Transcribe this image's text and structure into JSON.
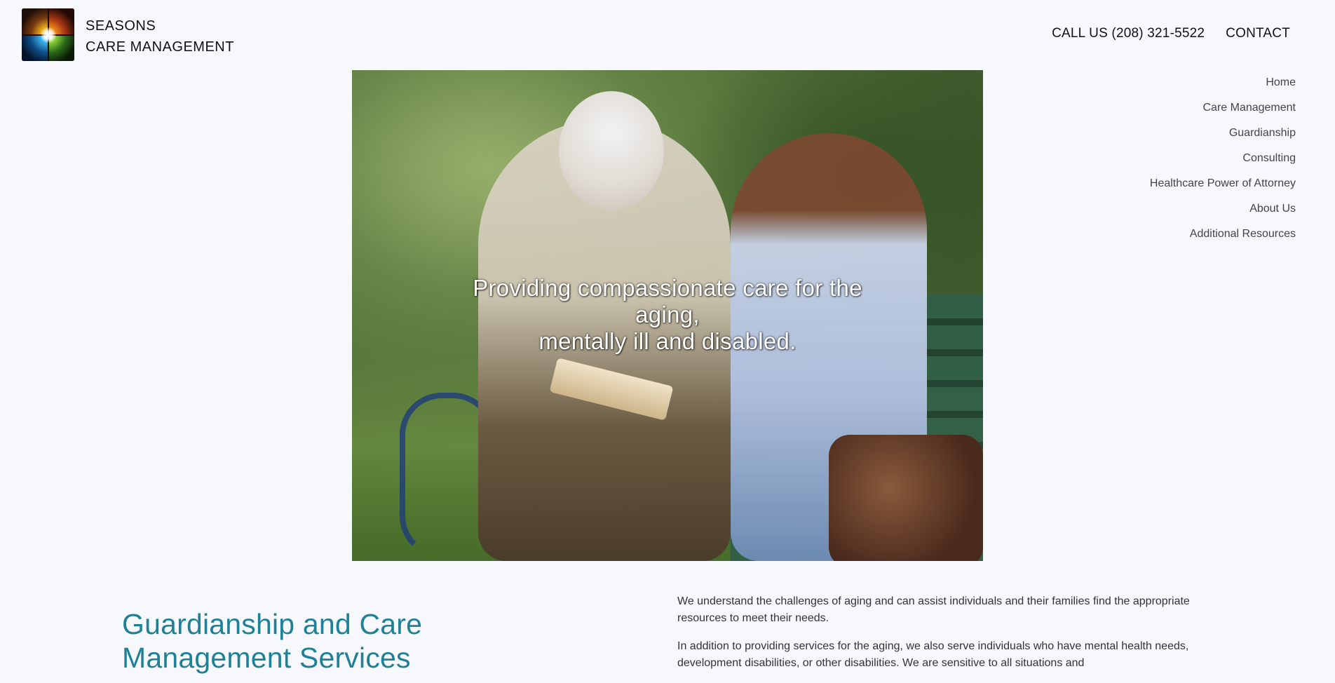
{
  "header": {
    "brand_line1": "SEASONS",
    "brand_line2": "CARE MANAGEMENT",
    "call_label": "CALL US (208) 321-5522",
    "contact_label": "CONTACT"
  },
  "side_nav": {
    "items": [
      {
        "label": "Home"
      },
      {
        "label": "Care Management"
      },
      {
        "label": "Guardianship"
      },
      {
        "label": "Consulting"
      },
      {
        "label": "Healthcare Power of Attorney"
      },
      {
        "label": "About Us"
      },
      {
        "label": "Additional Resources"
      }
    ]
  },
  "hero": {
    "tagline_line1": "Providing compassionate care for the",
    "tagline_line2": "aging,",
    "tagline_line3": "mentally ill and disabled."
  },
  "intro": {
    "title": "Guardianship and Care Management Services",
    "paragraph1": "We understand the challenges of aging and can assist individuals and their families find the appropriate resources to meet their needs.",
    "paragraph2": "In addition to providing services for the aging, we also serve individuals who have mental health needs, development disabilities, or other disabilities. We are sensitive to all situations and"
  },
  "colors": {
    "background": "#f6f8fb",
    "accent_title": "#1f8097",
    "nav_text": "#444444",
    "header_text": "#111111"
  }
}
